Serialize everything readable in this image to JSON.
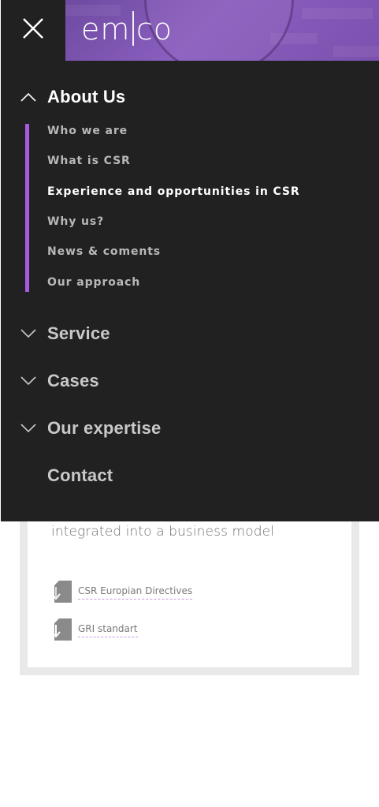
{
  "logo": {
    "text_left": "em",
    "text_right": "co"
  },
  "menu": {
    "sections": [
      {
        "label": "About Us",
        "expanded": true
      },
      {
        "label": "Service",
        "expanded": false
      },
      {
        "label": "Cases",
        "expanded": false
      },
      {
        "label": "Our expertise",
        "expanded": false
      },
      {
        "label": "Contact",
        "expanded": false
      }
    ],
    "about_items": [
      {
        "label": "Who we are"
      },
      {
        "label": "What is CSR"
      },
      {
        "label": "Experience and opportunities in CSR",
        "current": true
      },
      {
        "label": "Why us?"
      },
      {
        "label": "News & coments"
      },
      {
        "label": "Our approach"
      }
    ]
  },
  "content": {
    "text": "integrated into a business model",
    "documents": [
      {
        "label": "CSR Europian Directives"
      },
      {
        "label": "GRI standart"
      }
    ]
  },
  "colors": {
    "menu_bg": "#212121",
    "accent": "#a85bdf",
    "banner": "#7b50ae"
  }
}
